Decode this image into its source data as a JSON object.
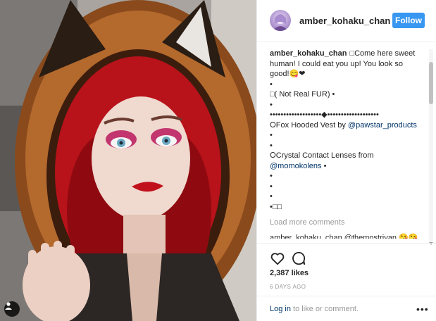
{
  "header": {
    "username": "amber_kohaku_chan",
    "follow_label": "Follow"
  },
  "caption": {
    "username": "amber_kohaku_chan",
    "lines": [
      "□Come here sweet human! I could eat you up! You look so good!😋❤",
      "•",
      "□( Not Real FUR) •",
      "•",
      "•••••••••••••••••••◆•••••••••••••••••••",
      "⭘Fox Hooded Vest by ",
      "•",
      "•",
      "⭘Crystal Contact Lenses from",
      "",
      "•",
      "•",
      "•",
      "•□□"
    ],
    "mention_vest": "@pawstar_products",
    "mention_lenses": "@momokolens",
    "mention_lenses_suffix": " •"
  },
  "comments": {
    "load_more_label": "Load more comments",
    "partial_comment": "amber_kohaku_chan @themostriyan 😘😘"
  },
  "actions": {
    "like_icon": "heart-icon",
    "comment_icon": "comment-icon",
    "likes_count": "2,387 likes",
    "time_ago": "6 DAYS AGO"
  },
  "login_bar": {
    "login_link": "Log in",
    "login_suffix": " to like or comment.",
    "more_options": "•••"
  },
  "colors": {
    "follow_blue": "#3897f0",
    "link_navy": "#003569",
    "muted_gray": "#999999",
    "text_dark": "#262626"
  }
}
